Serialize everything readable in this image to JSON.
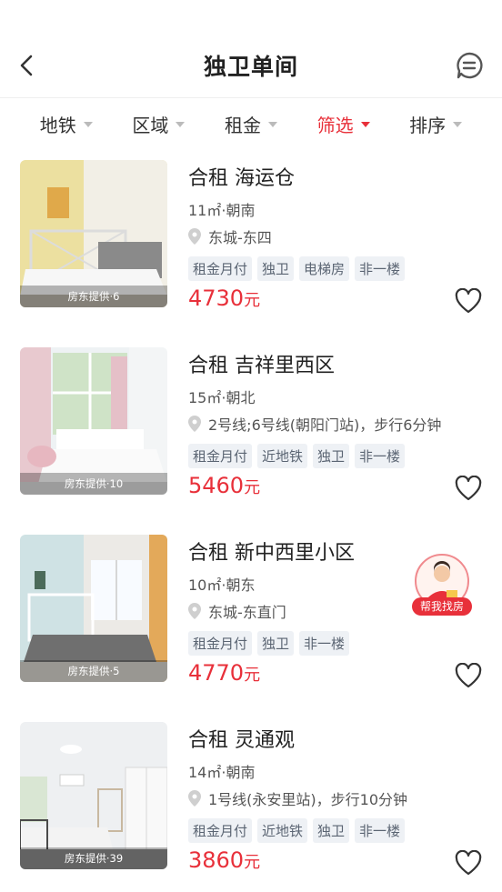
{
  "header": {
    "title": "独卫单间",
    "back_icon": "back-arrow-icon",
    "message_icon": "message-icon"
  },
  "filters": [
    {
      "label": "地铁",
      "active": false
    },
    {
      "label": "区域",
      "active": false
    },
    {
      "label": "租金",
      "active": false
    },
    {
      "label": "筛选",
      "active": true
    },
    {
      "label": "排序",
      "active": false
    }
  ],
  "listings": [
    {
      "title": "合租 海运仓",
      "spec": "11㎡·朝南",
      "location": "东城-东四",
      "tags": [
        "租金月付",
        "独卫",
        "电梯房",
        "非一楼"
      ],
      "price": "4730",
      "unit": "元",
      "photo_badge": "房东提供·6"
    },
    {
      "title": "合租 吉祥里西区",
      "spec": "15㎡·朝北",
      "location": "2号线;6号线(朝阳门站)，步行6分钟",
      "tags": [
        "租金月付",
        "近地铁",
        "独卫",
        "非一楼"
      ],
      "price": "5460",
      "unit": "元",
      "photo_badge": "房东提供·10"
    },
    {
      "title": "合租 新中西里小区",
      "spec": "10㎡·朝东",
      "location": "东城-东直门",
      "tags": [
        "租金月付",
        "独卫",
        "非一楼"
      ],
      "price": "4770",
      "unit": "元",
      "photo_badge": "房东提供·5"
    },
    {
      "title": "合租 灵通观",
      "spec": "14㎡·朝南",
      "location": "1号线(永安里站)，步行10分钟",
      "tags": [
        "租金月付",
        "近地铁",
        "独卫",
        "非一楼"
      ],
      "price": "3860",
      "unit": "元",
      "photo_badge": "房东提供·39"
    }
  ],
  "helper": {
    "label": "帮我找房"
  },
  "colors": {
    "accent": "#e8303a",
    "tag_bg": "#eef1f5",
    "text": "#222222"
  }
}
